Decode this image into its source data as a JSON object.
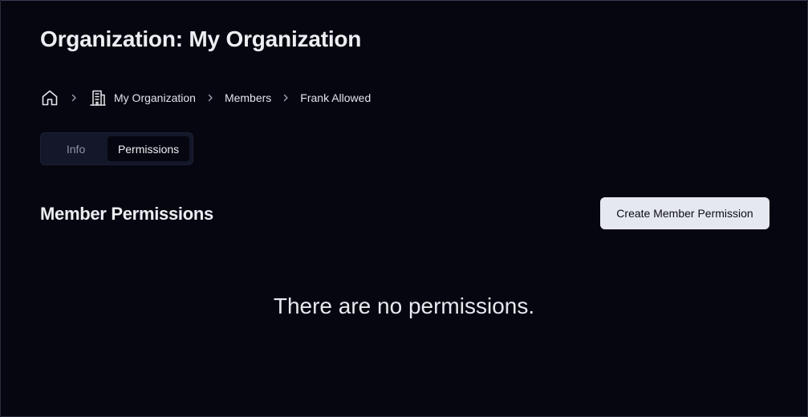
{
  "header": {
    "title": "Organization: My Organization"
  },
  "breadcrumb": {
    "items": [
      {
        "label": "My Organization",
        "icon": "building-icon"
      },
      {
        "label": "Members"
      },
      {
        "label": "Frank Allowed"
      }
    ],
    "home_icon": "home-icon",
    "separator_icon": "chevron-right-icon"
  },
  "tabs": [
    {
      "label": "Info",
      "active": false
    },
    {
      "label": "Permissions",
      "active": true
    }
  ],
  "section": {
    "title": "Member Permissions",
    "create_button_label": "Create Member Permission",
    "empty_message": "There are no permissions."
  },
  "colors": {
    "background": "#05060f",
    "button_bg": "#e6e8ef",
    "tab_track": "#141729",
    "muted_text": "#8d91a3"
  }
}
